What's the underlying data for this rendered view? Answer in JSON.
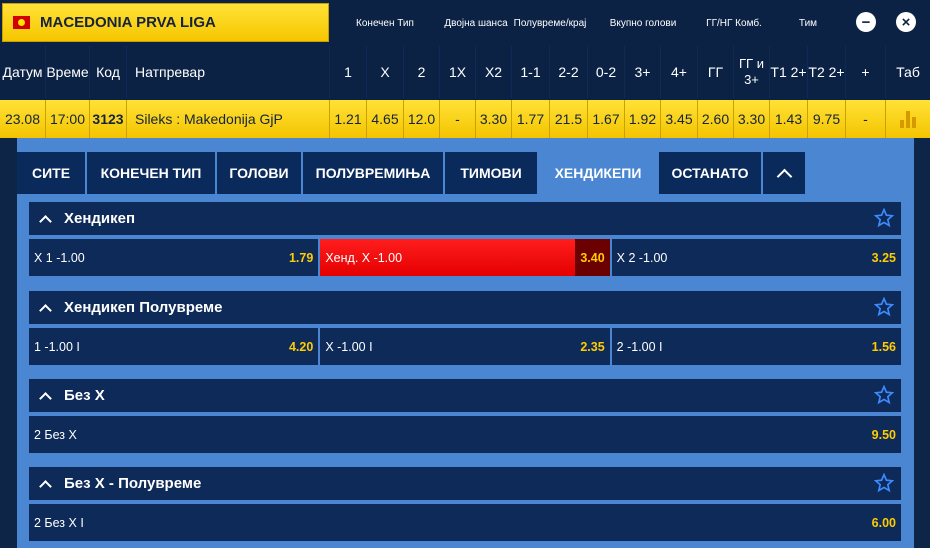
{
  "league": {
    "name": "MACEDONIA PRVA LIGA"
  },
  "groups": [
    {
      "label": "Конечен Тип"
    },
    {
      "label": "Двојна шанса"
    },
    {
      "label": "Полувреме/крај"
    },
    {
      "label": "Вкупно голови"
    },
    {
      "label": "ГГ/НГ Комб."
    },
    {
      "label": "Тим"
    }
  ],
  "controls": {
    "minimize": "−",
    "close": "×"
  },
  "columns": [
    "Датум",
    "Време",
    "Код",
    "Натпревар",
    "1",
    "X",
    "2",
    "1X",
    "X2",
    "1-1",
    "2-2",
    "0-2",
    "3+",
    "4+",
    "ГГ",
    "ГГ и 3+",
    "Т1 2+",
    "Т2 2+",
    "+",
    "Таб"
  ],
  "match": {
    "date": "23.08",
    "time": "17:00",
    "code": "3123",
    "name": "Sileks : Makedonija GjP",
    "odds": [
      "1.21",
      "4.65",
      "12.0",
      "-",
      "3.30",
      "1.77",
      "21.5",
      "1.67",
      "1.92",
      "3.45",
      "2.60",
      "3.30",
      "1.43",
      "9.75",
      "-"
    ]
  },
  "tabs": [
    "СИТЕ",
    "КОНЕЧЕН ТИП",
    "ГОЛОВИ",
    "ПОЛУВРЕМИЊА",
    "ТИМОВИ",
    "ХЕНДИКЕПИ",
    "ОСТАНАТО"
  ],
  "active_tab": "ХЕНДИКЕПИ",
  "markets": [
    {
      "title": "Хендикеп",
      "options": [
        {
          "label": "X 1 -1.00",
          "value": "1.79"
        },
        {
          "label": "Хенд. X -1.00",
          "value": "3.40",
          "selected": true
        },
        {
          "label": "X 2 -1.00",
          "value": "3.25"
        }
      ]
    },
    {
      "title": "Хендикеп Полувреме",
      "options": [
        {
          "label": "1 -1.00 I",
          "value": "4.20"
        },
        {
          "label": "X -1.00 I",
          "value": "2.35"
        },
        {
          "label": "2 -1.00 I",
          "value": "1.56"
        }
      ]
    },
    {
      "title": "Без X",
      "options": [
        {
          "label": "2 Без X",
          "value": "9.50"
        }
      ]
    },
    {
      "title": "Без X - Полувреме",
      "options": [
        {
          "label": "2 Без X I",
          "value": "6.00"
        }
      ]
    }
  ],
  "colors": {
    "accent_yellow": "#ffcc00",
    "header_navy": "#0b2244",
    "selected_red": "#ff1d1d",
    "panel_blue": "#4a86d2"
  }
}
